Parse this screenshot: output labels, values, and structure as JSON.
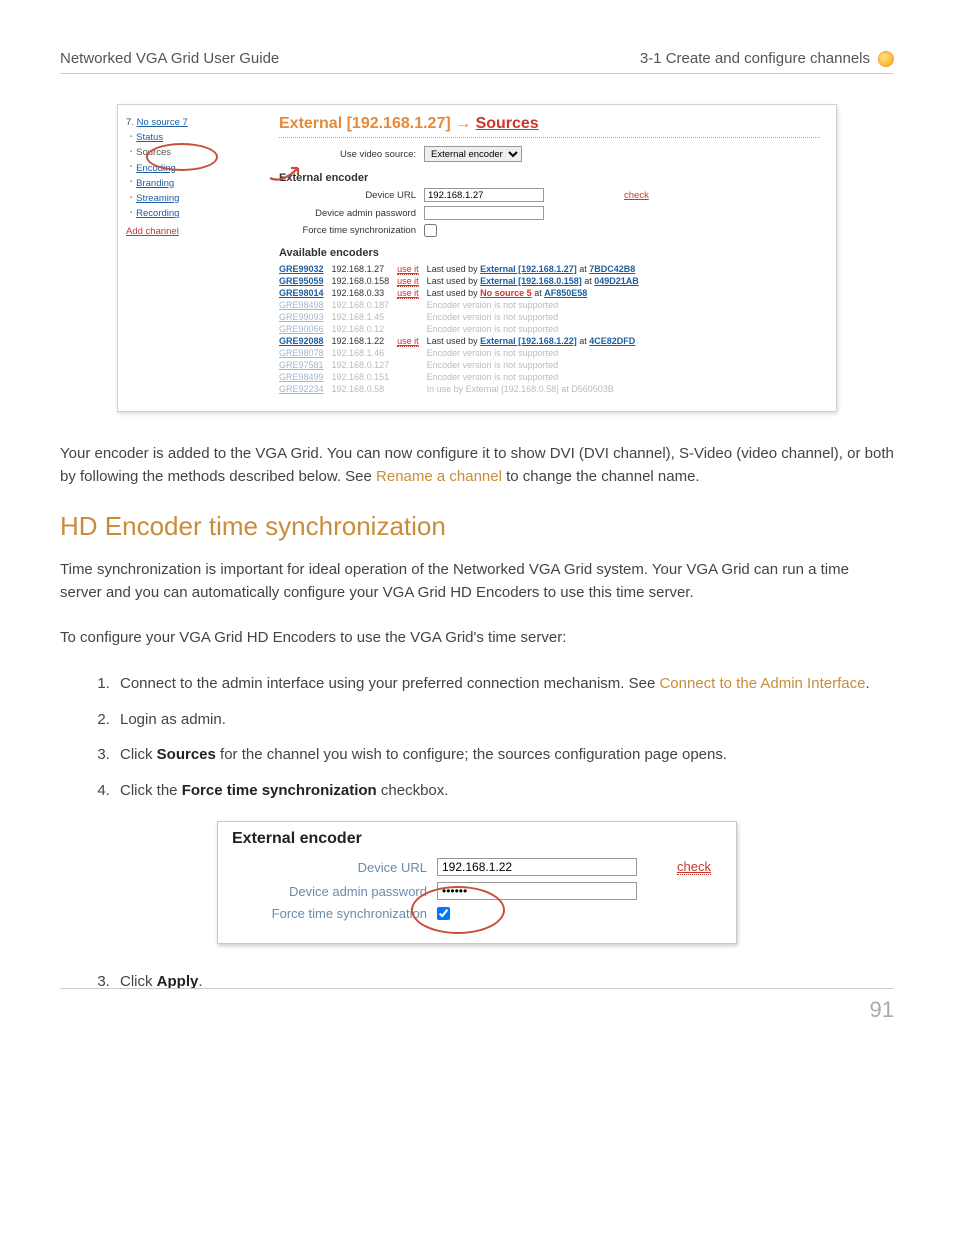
{
  "header": {
    "left": "Networked VGA Grid User Guide",
    "right": "3-1 Create and configure channels"
  },
  "shot1": {
    "sidebar": {
      "channel_num": "7.",
      "channel_name": "No source 7",
      "items": [
        "Status",
        "Sources",
        "Encoding",
        "Branding",
        "Streaming",
        "Recording"
      ],
      "add": "Add channel"
    },
    "title_prefix": "External [192.168.1.27]",
    "title_arrow": " → ",
    "title_suffix": "Sources",
    "use_label": "Use video source:",
    "use_value": "External encoder",
    "ext_title": "External encoder",
    "device_url_label": "Device URL",
    "device_url_value": "192.168.1.27",
    "check": "check",
    "device_pw_label": "Device admin password",
    "force_label": "Force time synchronization",
    "avail_title": "Available encoders",
    "encoders": [
      {
        "name": "GRE99032",
        "ip": "192.168.1.27",
        "use": "use it",
        "note_pre": "Last used by ",
        "link": "External [192.168.1.27]",
        "note_mid": " at ",
        "mac": "7BDC42B8",
        "dim": false
      },
      {
        "name": "GRE95059",
        "ip": "192.168.0.158",
        "use": "use it",
        "note_pre": "Last used by ",
        "link": "External [192.168.0.158]",
        "note_mid": " at ",
        "mac": "049D21AB",
        "dim": false
      },
      {
        "name": "GRE98014",
        "ip": "192.168.0.33",
        "use": "use it",
        "note_pre": "Last used by ",
        "link": "No source 5",
        "link_red": true,
        "note_mid": " at ",
        "mac": "AF850E58",
        "dim": false
      },
      {
        "name": "GRE98498",
        "ip": "192.168.0.187",
        "use": "",
        "note": "Encoder version is not supported",
        "dim": true
      },
      {
        "name": "GRE99093",
        "ip": "192.168.1.45",
        "use": "",
        "note": "Encoder version is not supported",
        "dim": true
      },
      {
        "name": "GRE90066",
        "ip": "192.168.0.12",
        "use": "",
        "note": "Encoder version is not supported",
        "dim": true
      },
      {
        "name": "GRE92088",
        "ip": "192.168.1.22",
        "use": "use it",
        "note_pre": "Last used by ",
        "link": "External [192.168.1.22]",
        "note_mid": " at ",
        "mac": "4CE82DFD",
        "dim": false
      },
      {
        "name": "GRE98078",
        "ip": "192.168.1.46",
        "use": "",
        "note": "Encoder version is not supported",
        "dim": true
      },
      {
        "name": "GRE97581",
        "ip": "192.168.0.127",
        "use": "",
        "note": "Encoder version is not supported",
        "dim": true
      },
      {
        "name": "GRE98499",
        "ip": "192.168.0.151",
        "use": "",
        "note": "Encoder version is not supported",
        "dim": true
      },
      {
        "name": "GRE92234",
        "ip": "192.168.0.58",
        "use": "",
        "note_pre": "In use by ",
        "note_link_plain": "External [192.168.0.58]",
        "note_mid": " at ",
        "mac": "D560503B",
        "dim": true
      }
    ]
  },
  "para1_a": "Your encoder is added to the VGA Grid. You can now configure it to show DVI (DVI channel), S-Video (video channel), or both by following the methods described below. See ",
  "para1_link": "Rename a channel",
  "para1_b": " to change the channel name.",
  "h2": "HD Encoder time synchronization",
  "para2": "Time synchronization is important for ideal operation of the Networked VGA Grid system. Your VGA Grid can run a time server and you can automatically configure your VGA Grid HD Encoders to use this time server.",
  "para3": "To configure your VGA Grid HD Encoders to use the VGA Grid's time server:",
  "steps": {
    "s1a": "Connect to the admin interface using your preferred connection mechanism. See ",
    "s1link": "Connect to the Admin Interface",
    "s1b": ".",
    "s2": "Login as admin.",
    "s3a": "Click ",
    "s3b": "Sources",
    "s3c": " for the channel you wish to configure; the sources configuration page opens.",
    "s4a": "Click the ",
    "s4b": "Force time synchronization",
    "s4c": " checkbox.",
    "s5a": "Click ",
    "s5b": "Apply",
    "s5c": "."
  },
  "shot2": {
    "title": "External encoder",
    "device_url_label": "Device URL",
    "device_url_value": "192.168.1.22",
    "check": "check",
    "pw_label": "Device admin password",
    "pw_value": "••••••",
    "force_label": "Force time synchronization"
  },
  "page_number": "91"
}
